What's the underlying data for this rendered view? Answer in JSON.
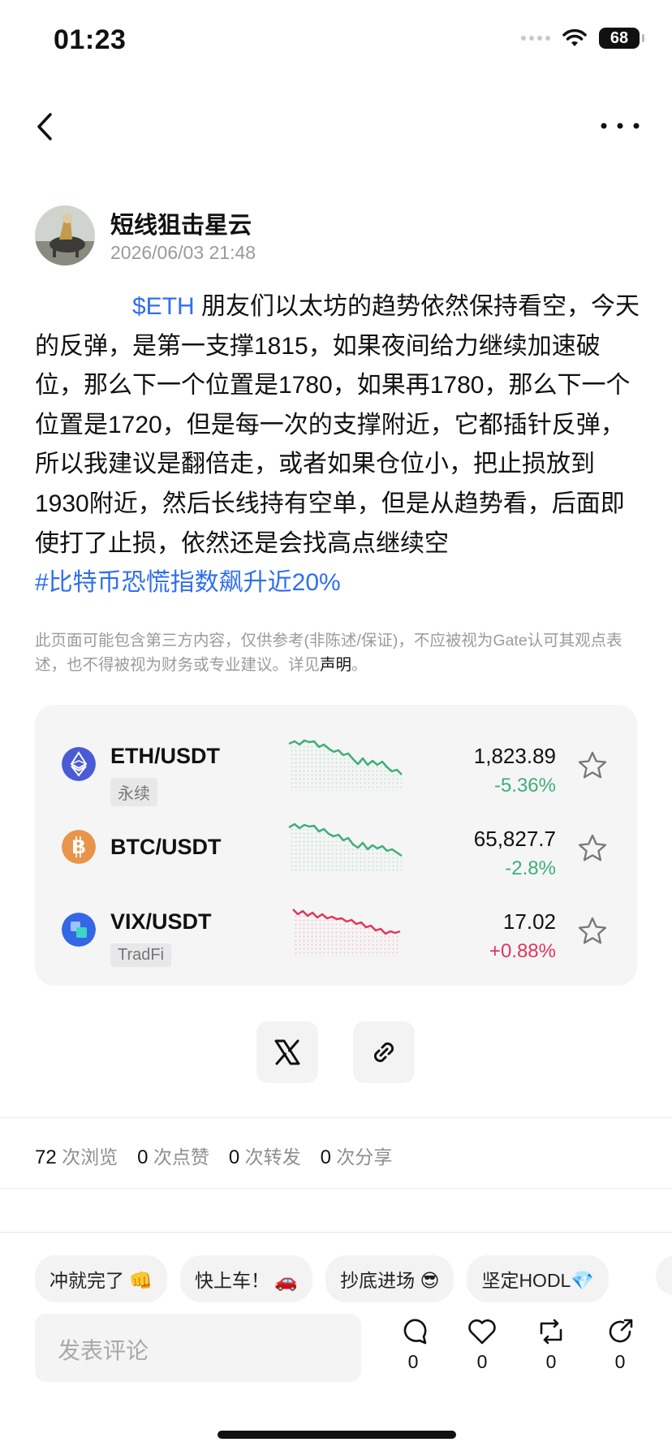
{
  "status_bar": {
    "time": "01:23",
    "battery": "68"
  },
  "author": {
    "name": "短线狙击星云",
    "time": "2026/06/03 21:48"
  },
  "post": {
    "ticker": "$ETH",
    "text": " 朋友们以太坊的趋势依然保持看空，今天的反弹，是第一支撑1815，如果夜间给力继续加速破位，那么下一个位置是1780，如果再1780，那么下一个位置是1720，但是每一次的支撑附近，它都插针反弹，所以我建议是翻倍走，或者如果仓位小，把止损放到1930附近，然后长线持有空单，但是从趋势看，后面即使打了止损，依然还是会找高点继续空",
    "hashtag": "#比特币恐慌指数飙升近20%"
  },
  "disclaimer": {
    "text": "此页面可能包含第三方内容，仅供参考(非陈述/保证)，不应被视为Gate认可其观点表述，也不得被视为财务或专业建议。详见",
    "link": "声明",
    "end": "。"
  },
  "markets": [
    {
      "pair": "ETH/USDT",
      "tag": "永续",
      "price": "1,823.89",
      "change": "-5.36%",
      "icon": "ethereum-icon",
      "direction": "down",
      "color": "#4a5bd6"
    },
    {
      "pair": "BTC/USDT",
      "tag": "",
      "price": "65,827.7",
      "change": "-2.8%",
      "icon": "bitcoin-icon",
      "direction": "down",
      "color": "#e8944a"
    },
    {
      "pair": "VIX/USDT",
      "tag": "TradFi",
      "price": "17.02",
      "change": "+0.88%",
      "icon": "vix-icon",
      "direction": "up",
      "color": "#3566e6"
    }
  ],
  "stats": [
    {
      "count": "72",
      "label": "次浏览"
    },
    {
      "count": "0",
      "label": "次点赞"
    },
    {
      "count": "0",
      "label": "次转发"
    },
    {
      "count": "0",
      "label": "次分享"
    }
  ],
  "quick_replies": [
    "冲就完了 👊",
    "快上车！ 🚗",
    "抄底进场 😎",
    "坚定HODL💎"
  ],
  "comment": {
    "placeholder": "发表评论"
  },
  "actions": [
    {
      "icon": "comment-icon",
      "count": "0"
    },
    {
      "icon": "heart-icon",
      "count": "0"
    },
    {
      "icon": "repost-icon",
      "count": "0"
    },
    {
      "icon": "share-icon",
      "count": "0"
    }
  ],
  "colors": {
    "accent": "#2f6ef1",
    "down": "#3fae79",
    "up": "#e0375b"
  }
}
